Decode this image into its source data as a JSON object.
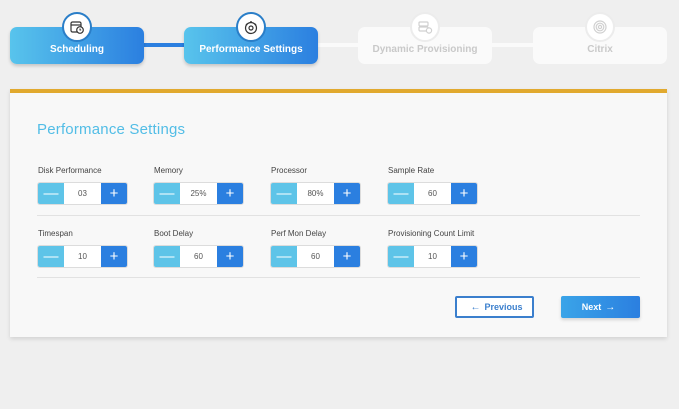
{
  "wizard": {
    "steps": [
      {
        "label": "Scheduling",
        "state": "active",
        "icon": "calendar-clock-icon"
      },
      {
        "label": "Performance Settings",
        "state": "active",
        "icon": "gear-gauge-icon"
      },
      {
        "label": "Dynamic Provisioning",
        "state": "inactive",
        "icon": "servers-gear-icon"
      },
      {
        "label": "Citrix",
        "state": "inactive",
        "icon": "citrix-spiral-icon"
      }
    ]
  },
  "section": {
    "title": "Performance Settings"
  },
  "fields": [
    {
      "label": "Disk Performance",
      "value": "03"
    },
    {
      "label": "Memory",
      "value": "25%"
    },
    {
      "label": "Processor",
      "value": "80%"
    },
    {
      "label": "Sample Rate",
      "value": "60"
    },
    {
      "label": "Timespan",
      "value": "10"
    },
    {
      "label": "Boot Delay",
      "value": "60"
    },
    {
      "label": "Perf Mon Delay",
      "value": "60"
    },
    {
      "label": "Provisioning Count Limit",
      "value": "10"
    }
  ],
  "stepper_glyphs": {
    "minus": "—",
    "plus": "+"
  },
  "actions": {
    "previous": {
      "label": "Previous",
      "arrow": "←"
    },
    "next": {
      "label": "Next",
      "arrow": "→"
    }
  },
  "colors": {
    "accent_light": "#5ec4e8",
    "accent_dark": "#2b7fe0",
    "card_top_border": "#e1a92e",
    "title": "#52bde6"
  }
}
